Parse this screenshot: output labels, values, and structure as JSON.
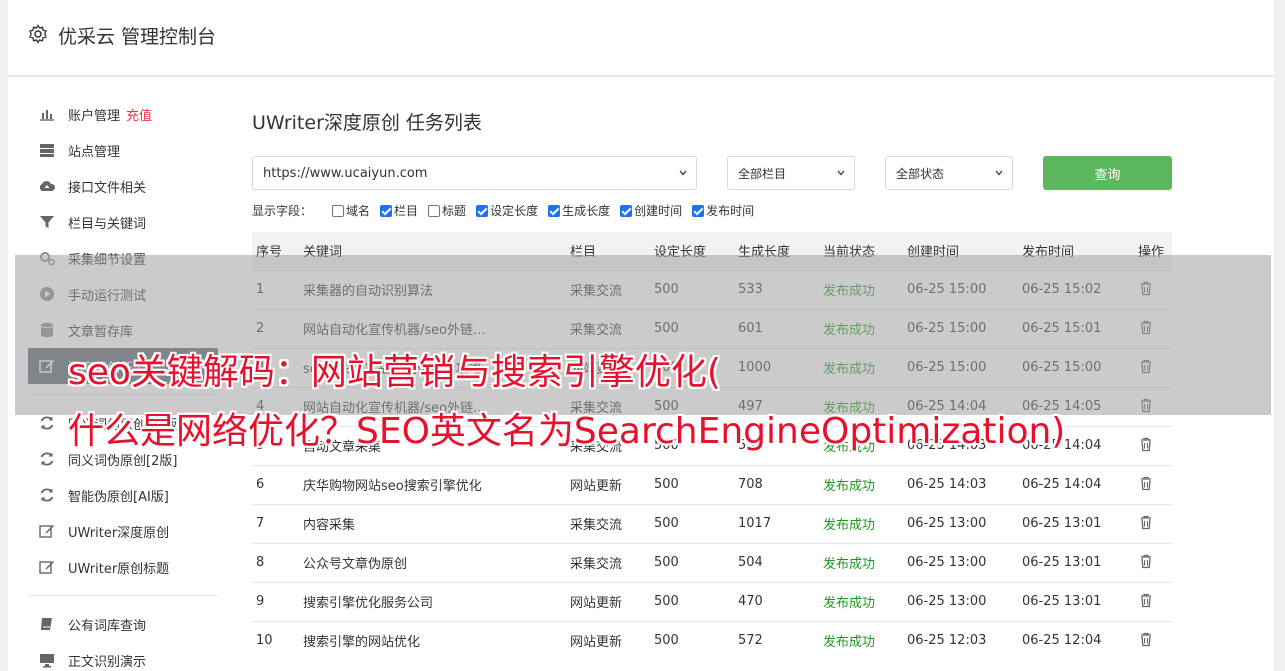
{
  "header": {
    "title": "优采云 管理控制台"
  },
  "sidebar": {
    "items": [
      {
        "label": "账户管理",
        "extra": "充值",
        "icon": "bar-chart-icon"
      },
      {
        "label": "站点管理",
        "icon": "server-icon"
      },
      {
        "label": "接口文件相关",
        "icon": "cloud-upload-icon"
      },
      {
        "label": "栏目与关键词",
        "icon": "filter-icon"
      },
      {
        "label": "采集细节设置",
        "icon": "gears-icon"
      },
      {
        "label": "手动运行测试",
        "icon": "play-icon"
      },
      {
        "label": "文章暂存库",
        "icon": "database-icon"
      },
      {
        "label": "深度原创任务",
        "icon": "edit-icon"
      },
      {
        "label": "同义词伪原创[旧版]",
        "icon": "refresh-icon"
      },
      {
        "label": "同义词伪原创[2版]",
        "icon": "refresh-icon"
      },
      {
        "label": "智能伪原创[AI版]",
        "icon": "refresh-icon"
      },
      {
        "label": "UWriter深度原创",
        "icon": "edit-icon"
      },
      {
        "label": "UWriter原创标题",
        "icon": "edit-icon"
      },
      {
        "label": "公有词库查询",
        "icon": "book-icon"
      },
      {
        "label": "正文识别演示",
        "icon": "monitor-icon"
      }
    ]
  },
  "main": {
    "title": "UWriter深度原创 任务列表",
    "url_select": "https://www.ucaiyun.com",
    "column_select": "全部栏目",
    "status_select": "全部状态",
    "query_label": "查询",
    "fields_label": "显示字段：",
    "fields": [
      {
        "label": "域名",
        "checked": false
      },
      {
        "label": "栏目",
        "checked": true
      },
      {
        "label": "标题",
        "checked": false
      },
      {
        "label": "设定长度",
        "checked": true
      },
      {
        "label": "生成长度",
        "checked": true
      },
      {
        "label": "创建时间",
        "checked": true
      },
      {
        "label": "发布时间",
        "checked": true
      }
    ],
    "columns": [
      "序号",
      "关键词",
      "栏目",
      "设定长度",
      "生成长度",
      "当前状态",
      "创建时间",
      "发布时间",
      "操作"
    ],
    "rows": [
      [
        "1",
        "采集器的自动识别算法",
        "采集交流",
        "500",
        "533",
        "发布成功",
        "06-25 15:00",
        "06-25 15:02"
      ],
      [
        "2",
        "网站自动化宣传机器/seo外链...",
        "采集交流",
        "500",
        "601",
        "发布成功",
        "06-25 15:00",
        "06-25 15:01"
      ],
      [
        "3",
        "seo兵书：实战营销优化全攻略",
        "网站更新",
        "500",
        "1000",
        "发布成功",
        "06-25 15:00",
        "06-25 15:00"
      ],
      [
        "4",
        "网站自动化宣传机器/seo外链...",
        "采集交流",
        "500",
        "497",
        "发布成功",
        "06-25 14:04",
        "06-25 14:05"
      ],
      [
        "5",
        "自动文章采集",
        "采集交流",
        "500",
        "554",
        "发布成功",
        "06-25 14:03",
        "06-25 14:04"
      ],
      [
        "6",
        "庆华购物网站seo搜索引擎优化",
        "网站更新",
        "500",
        "708",
        "发布成功",
        "06-25 14:03",
        "06-25 14:04"
      ],
      [
        "7",
        "内容采集",
        "采集交流",
        "500",
        "1017",
        "发布成功",
        "06-25 13:00",
        "06-25 13:01"
      ],
      [
        "8",
        "公众号文章伪原创",
        "采集交流",
        "500",
        "504",
        "发布成功",
        "06-25 13:00",
        "06-25 13:01"
      ],
      [
        "9",
        "搜索引擎优化服务公司",
        "网站更新",
        "500",
        "470",
        "发布成功",
        "06-25 13:00",
        "06-25 13:01"
      ],
      [
        "10",
        "搜索引擎的网站优化",
        "网站更新",
        "500",
        "572",
        "发布成功",
        "06-25 12:03",
        "06-25 12:04"
      ]
    ]
  },
  "overlay": {
    "line1": "seo关键解码：网站营销与搜索引擎优化(",
    "line2": "什么是网络优化？SEO英文名为SearchEngineOptimization)"
  },
  "colors": {
    "accent": "#5cb85c",
    "status_ok": "#1e9a1e",
    "headline": "#e8112d",
    "active_nav": "#5b6470"
  }
}
